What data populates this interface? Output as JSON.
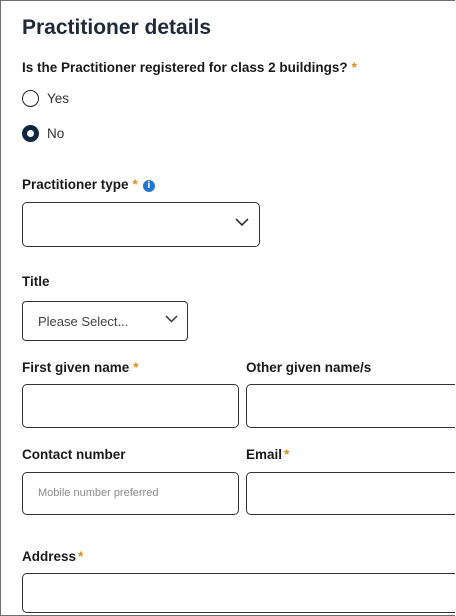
{
  "section": {
    "title": "Practitioner details"
  },
  "class2_question": {
    "label": "Is the Practitioner registered for class 2 buildings?",
    "required_mark": "*",
    "options": [
      {
        "label": "Yes",
        "selected": false
      },
      {
        "label": "No",
        "selected": true
      }
    ]
  },
  "practitioner_type": {
    "label": "Practitioner type",
    "required_mark": "*",
    "info_icon": "info-icon",
    "value": ""
  },
  "title_field": {
    "label": "Title",
    "value": "Please Select..."
  },
  "first_given_name": {
    "label": "First given name",
    "required_mark": "*",
    "value": ""
  },
  "other_given_names": {
    "label": "Other given name/s",
    "value": ""
  },
  "contact_number": {
    "label": "Contact number",
    "placeholder": "Mobile number preferred",
    "value": ""
  },
  "email": {
    "label": "Email",
    "required_mark": "*",
    "value": ""
  },
  "address": {
    "label": "Address",
    "required_mark": "*",
    "value": ""
  },
  "colors": {
    "required_star": "#e08a1e",
    "radio_selected": "#0e2841",
    "info_icon": "#1f77d0",
    "title_text": "#1e2a3a"
  }
}
